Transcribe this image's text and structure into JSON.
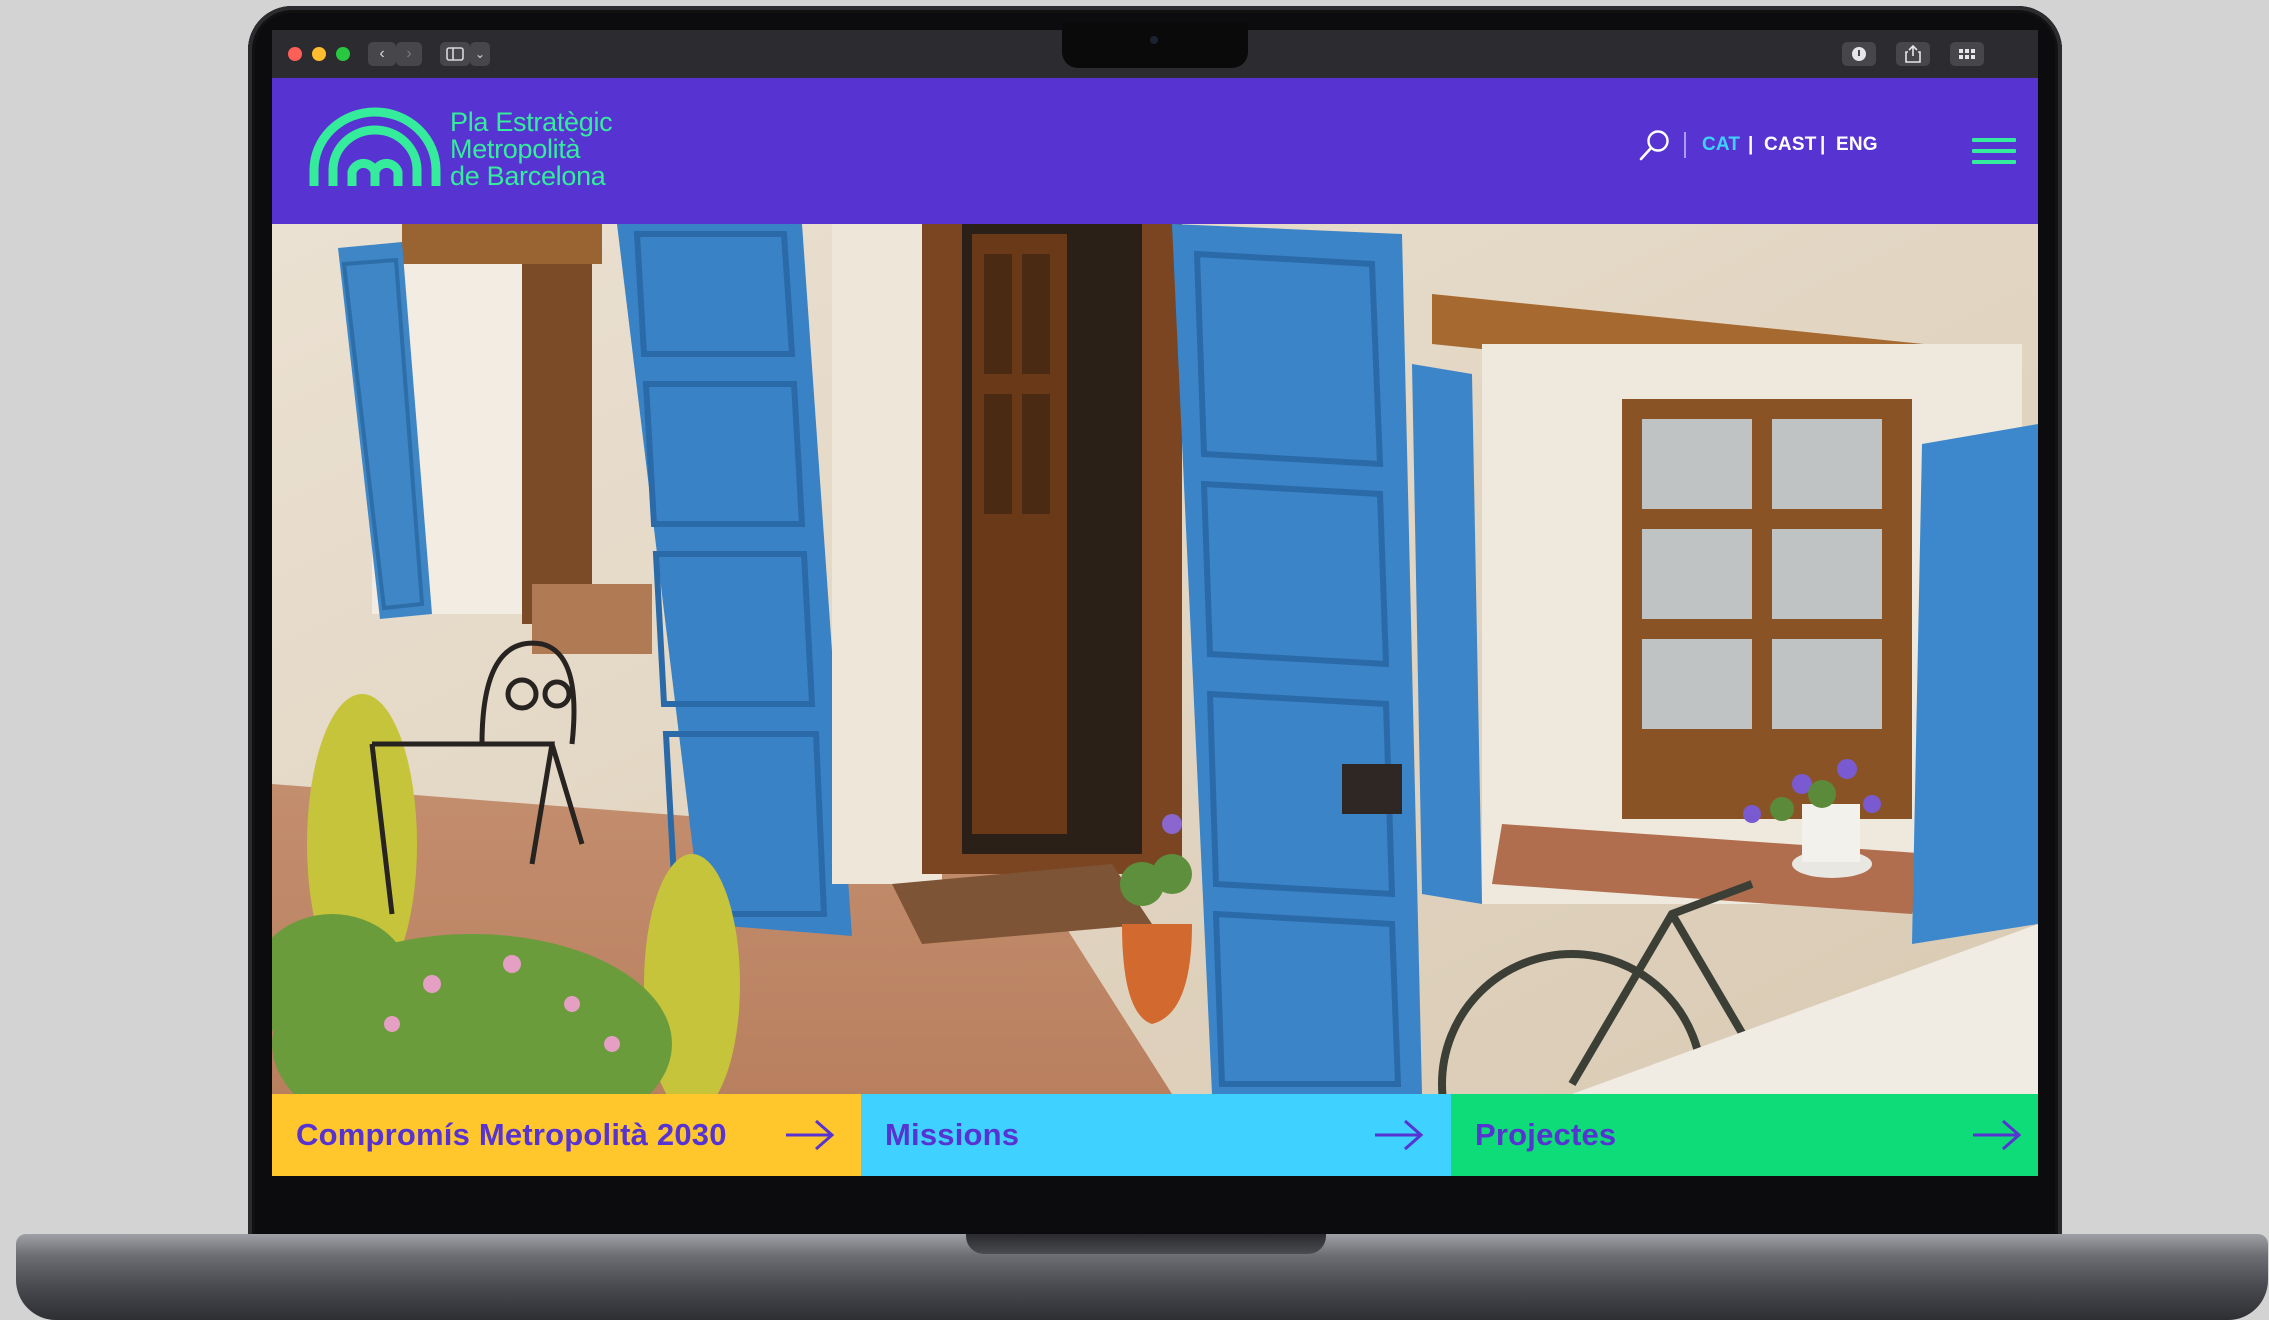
{
  "colors": {
    "brand_purple": "#5733d1",
    "brand_green": "#35ec9c",
    "lang_active": "#3fd1ff",
    "cta_yellow": "#ffc72c",
    "cta_cyan": "#3fd1ff",
    "cta_green": "#0edc79"
  },
  "browser": {
    "traffic_lights": [
      "close",
      "minimize",
      "zoom"
    ],
    "nav_icons": [
      "back-icon",
      "forward-icon",
      "sidebar-icon",
      "chevron-down-icon"
    ],
    "right_icons": [
      "privacy-icon",
      "share-icon",
      "tabs-overview-icon"
    ]
  },
  "header": {
    "logo_lines": [
      "Pla Estratègic",
      "Metropolità",
      "de Barcelona"
    ],
    "search_icon": "search-icon",
    "languages": [
      {
        "label": "CAT",
        "active": true
      },
      {
        "label": "CAST",
        "active": false
      },
      {
        "label": "ENG",
        "active": false
      }
    ],
    "language_separator": "|",
    "menu_icon": "hamburger-menu-icon"
  },
  "hero": {
    "image": "photo of whitewashed house with blue wooden shutters, open door, flowers, chair and bicycle"
  },
  "cta": [
    {
      "label": "Compromís Metropolità 2030",
      "color": "#ffc72c",
      "icon": "arrow-right-icon"
    },
    {
      "label": "Missions",
      "color": "#3fd1ff",
      "icon": "arrow-right-icon"
    },
    {
      "label": "Projectes",
      "color": "#0edc79",
      "icon": "arrow-right-icon"
    }
  ]
}
